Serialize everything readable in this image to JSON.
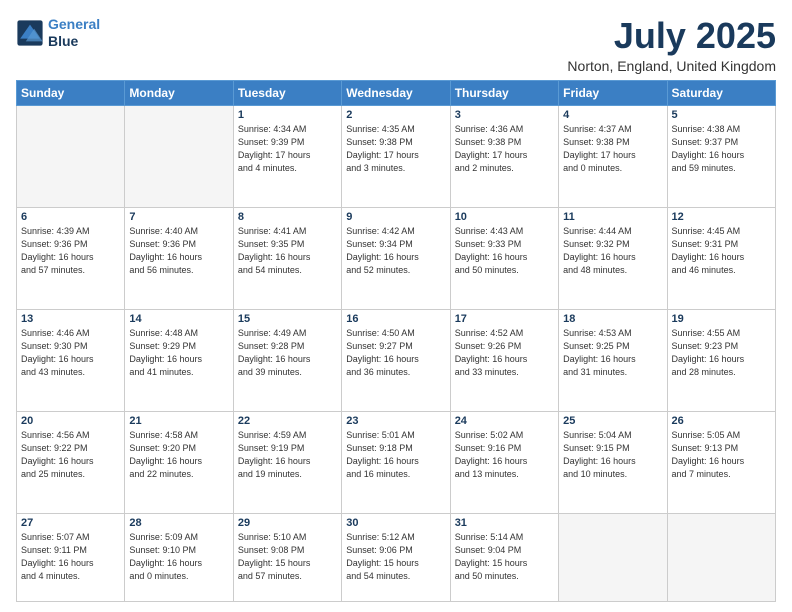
{
  "logo": {
    "line1": "General",
    "line2": "Blue"
  },
  "title": "July 2025",
  "location": "Norton, England, United Kingdom",
  "days_of_week": [
    "Sunday",
    "Monday",
    "Tuesday",
    "Wednesday",
    "Thursday",
    "Friday",
    "Saturday"
  ],
  "weeks": [
    [
      {
        "num": "",
        "info": ""
      },
      {
        "num": "",
        "info": ""
      },
      {
        "num": "1",
        "info": "Sunrise: 4:34 AM\nSunset: 9:39 PM\nDaylight: 17 hours\nand 4 minutes."
      },
      {
        "num": "2",
        "info": "Sunrise: 4:35 AM\nSunset: 9:38 PM\nDaylight: 17 hours\nand 3 minutes."
      },
      {
        "num": "3",
        "info": "Sunrise: 4:36 AM\nSunset: 9:38 PM\nDaylight: 17 hours\nand 2 minutes."
      },
      {
        "num": "4",
        "info": "Sunrise: 4:37 AM\nSunset: 9:38 PM\nDaylight: 17 hours\nand 0 minutes."
      },
      {
        "num": "5",
        "info": "Sunrise: 4:38 AM\nSunset: 9:37 PM\nDaylight: 16 hours\nand 59 minutes."
      }
    ],
    [
      {
        "num": "6",
        "info": "Sunrise: 4:39 AM\nSunset: 9:36 PM\nDaylight: 16 hours\nand 57 minutes."
      },
      {
        "num": "7",
        "info": "Sunrise: 4:40 AM\nSunset: 9:36 PM\nDaylight: 16 hours\nand 56 minutes."
      },
      {
        "num": "8",
        "info": "Sunrise: 4:41 AM\nSunset: 9:35 PM\nDaylight: 16 hours\nand 54 minutes."
      },
      {
        "num": "9",
        "info": "Sunrise: 4:42 AM\nSunset: 9:34 PM\nDaylight: 16 hours\nand 52 minutes."
      },
      {
        "num": "10",
        "info": "Sunrise: 4:43 AM\nSunset: 9:33 PM\nDaylight: 16 hours\nand 50 minutes."
      },
      {
        "num": "11",
        "info": "Sunrise: 4:44 AM\nSunset: 9:32 PM\nDaylight: 16 hours\nand 48 minutes."
      },
      {
        "num": "12",
        "info": "Sunrise: 4:45 AM\nSunset: 9:31 PM\nDaylight: 16 hours\nand 46 minutes."
      }
    ],
    [
      {
        "num": "13",
        "info": "Sunrise: 4:46 AM\nSunset: 9:30 PM\nDaylight: 16 hours\nand 43 minutes."
      },
      {
        "num": "14",
        "info": "Sunrise: 4:48 AM\nSunset: 9:29 PM\nDaylight: 16 hours\nand 41 minutes."
      },
      {
        "num": "15",
        "info": "Sunrise: 4:49 AM\nSunset: 9:28 PM\nDaylight: 16 hours\nand 39 minutes."
      },
      {
        "num": "16",
        "info": "Sunrise: 4:50 AM\nSunset: 9:27 PM\nDaylight: 16 hours\nand 36 minutes."
      },
      {
        "num": "17",
        "info": "Sunrise: 4:52 AM\nSunset: 9:26 PM\nDaylight: 16 hours\nand 33 minutes."
      },
      {
        "num": "18",
        "info": "Sunrise: 4:53 AM\nSunset: 9:25 PM\nDaylight: 16 hours\nand 31 minutes."
      },
      {
        "num": "19",
        "info": "Sunrise: 4:55 AM\nSunset: 9:23 PM\nDaylight: 16 hours\nand 28 minutes."
      }
    ],
    [
      {
        "num": "20",
        "info": "Sunrise: 4:56 AM\nSunset: 9:22 PM\nDaylight: 16 hours\nand 25 minutes."
      },
      {
        "num": "21",
        "info": "Sunrise: 4:58 AM\nSunset: 9:20 PM\nDaylight: 16 hours\nand 22 minutes."
      },
      {
        "num": "22",
        "info": "Sunrise: 4:59 AM\nSunset: 9:19 PM\nDaylight: 16 hours\nand 19 minutes."
      },
      {
        "num": "23",
        "info": "Sunrise: 5:01 AM\nSunset: 9:18 PM\nDaylight: 16 hours\nand 16 minutes."
      },
      {
        "num": "24",
        "info": "Sunrise: 5:02 AM\nSunset: 9:16 PM\nDaylight: 16 hours\nand 13 minutes."
      },
      {
        "num": "25",
        "info": "Sunrise: 5:04 AM\nSunset: 9:15 PM\nDaylight: 16 hours\nand 10 minutes."
      },
      {
        "num": "26",
        "info": "Sunrise: 5:05 AM\nSunset: 9:13 PM\nDaylight: 16 hours\nand 7 minutes."
      }
    ],
    [
      {
        "num": "27",
        "info": "Sunrise: 5:07 AM\nSunset: 9:11 PM\nDaylight: 16 hours\nand 4 minutes."
      },
      {
        "num": "28",
        "info": "Sunrise: 5:09 AM\nSunset: 9:10 PM\nDaylight: 16 hours\nand 0 minutes."
      },
      {
        "num": "29",
        "info": "Sunrise: 5:10 AM\nSunset: 9:08 PM\nDaylight: 15 hours\nand 57 minutes."
      },
      {
        "num": "30",
        "info": "Sunrise: 5:12 AM\nSunset: 9:06 PM\nDaylight: 15 hours\nand 54 minutes."
      },
      {
        "num": "31",
        "info": "Sunrise: 5:14 AM\nSunset: 9:04 PM\nDaylight: 15 hours\nand 50 minutes."
      },
      {
        "num": "",
        "info": ""
      },
      {
        "num": "",
        "info": ""
      }
    ]
  ]
}
